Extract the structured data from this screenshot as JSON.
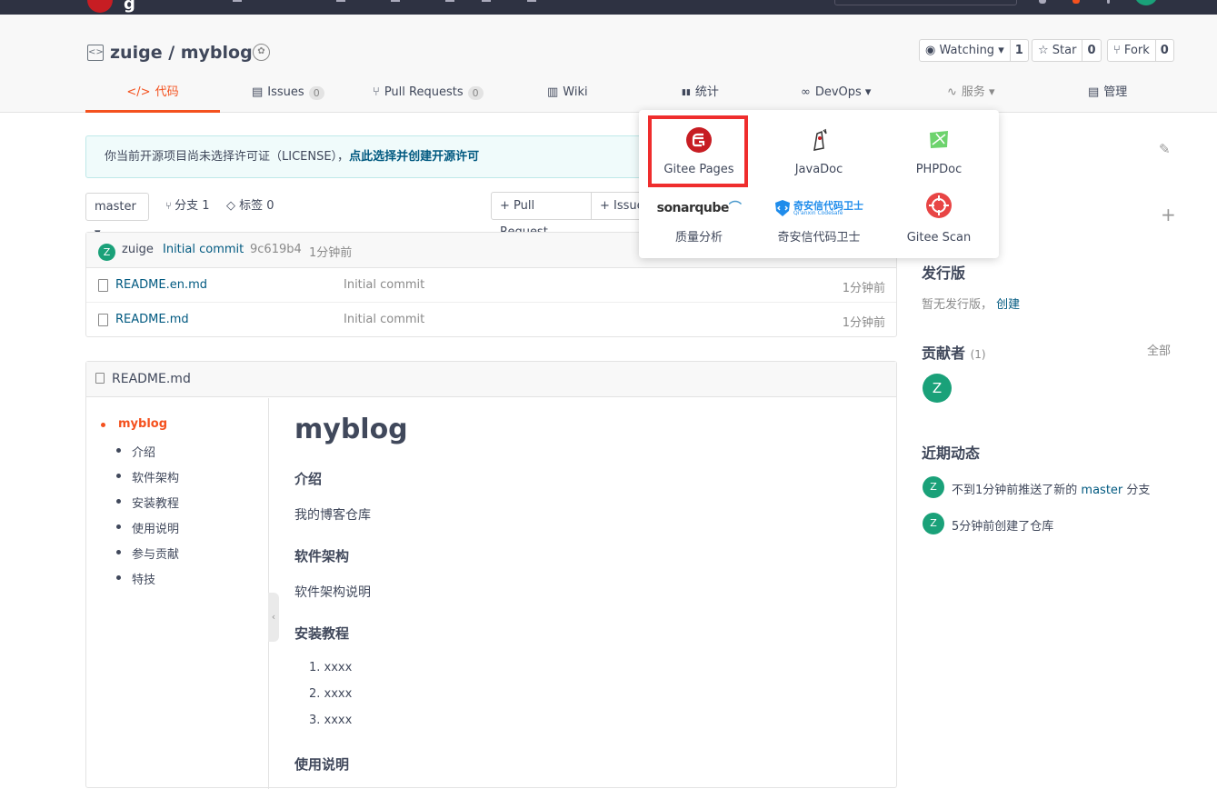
{
  "topbar": {
    "logo_letter": "g"
  },
  "repo": {
    "icon": "code-icon",
    "title": "zuige / myblog",
    "badge_icon": "award-icon"
  },
  "actions": {
    "watching": {
      "label": "Watching ▾",
      "count": "1"
    },
    "star": {
      "label": "☆ Star",
      "count": "0"
    },
    "fork": {
      "label": "⑂ Fork",
      "count": "0"
    }
  },
  "tabs": [
    {
      "label": "代码",
      "icon": "</>"
    },
    {
      "label": "Issues",
      "icon": "▤",
      "count": "0"
    },
    {
      "label": "Pull Requests",
      "icon": "⑂",
      "count": "0"
    },
    {
      "label": "Wiki",
      "icon": "▥"
    },
    {
      "label": "统计",
      "icon": "▮▮"
    },
    {
      "label": "DevOps ▾",
      "icon": "∞"
    },
    {
      "label": "服务 ▾",
      "icon": "∿"
    },
    {
      "label": "管理",
      "icon": "▤"
    }
  ],
  "notice": {
    "text": "你当前开源项目尚未选择许可证（LICENSE），",
    "link": "点此选择并创建开源许可"
  },
  "branch": {
    "current": "master ▾",
    "branches": "分支 1",
    "tags": "标签 0",
    "pull_request": "+ Pull Request",
    "issue": "+ Issue"
  },
  "commit": {
    "avatar": "Z",
    "author": "zuige",
    "message": "Initial commit",
    "hash": "9c619b4",
    "time": "1分钟前"
  },
  "files": [
    {
      "name": "README.en.md",
      "message": "Initial commit",
      "time": "1分钟前"
    },
    {
      "name": "README.md",
      "message": "Initial commit",
      "time": "1分钟前"
    }
  ],
  "readme": {
    "filename": "README.md",
    "toc": [
      "myblog",
      "介绍",
      "软件架构",
      "安装教程",
      "使用说明",
      "参与贡献",
      "特技"
    ],
    "title": "myblog",
    "h_intro": "介绍",
    "p_intro": "我的博客仓库",
    "h_arch": "软件架构",
    "p_arch": "软件架构说明",
    "h_install": "安装教程",
    "install_steps": [
      "xxxx",
      "xxxx",
      "xxxx"
    ],
    "h_usage": "使用说明"
  },
  "sidebar": {
    "release_title": "发行版",
    "release_text": "暂无发行版，",
    "release_link": "创建",
    "contrib_title": "贡献者",
    "contrib_count": "(1)",
    "contrib_all": "全部",
    "contrib_avatar": "Z",
    "activity_title": "近期动态",
    "activities": [
      {
        "avatar": "Z",
        "pre": "不到1分钟前推送了新的",
        "branch": "master",
        "post": "分支"
      },
      {
        "avatar": "Z",
        "pre": "5分钟前创建了仓库",
        "branch": "",
        "post": ""
      }
    ]
  },
  "services_menu": [
    {
      "label": "Gitee Pages",
      "icon": "gitee-pages-icon"
    },
    {
      "label": "JavaDoc",
      "icon": "javadoc-icon"
    },
    {
      "label": "PHPDoc",
      "icon": "phpdoc-icon"
    },
    {
      "label": "质量分析",
      "icon": "sonarqube-icon",
      "logo_text": "sonarqube"
    },
    {
      "label": "奇安信代码卫士",
      "icon": "qianxin-icon",
      "logo_text": "奇安信代码卫士",
      "logo_sub": "Qi'anxin Codesafe"
    },
    {
      "label": "Gitee Scan",
      "icon": "gitee-scan-icon"
    }
  ],
  "colors": {
    "accent": "#f4511e",
    "brand": "#c71d23",
    "link": "#005980",
    "avatar": "#1aa179",
    "highlight": "#ef2d2d"
  }
}
